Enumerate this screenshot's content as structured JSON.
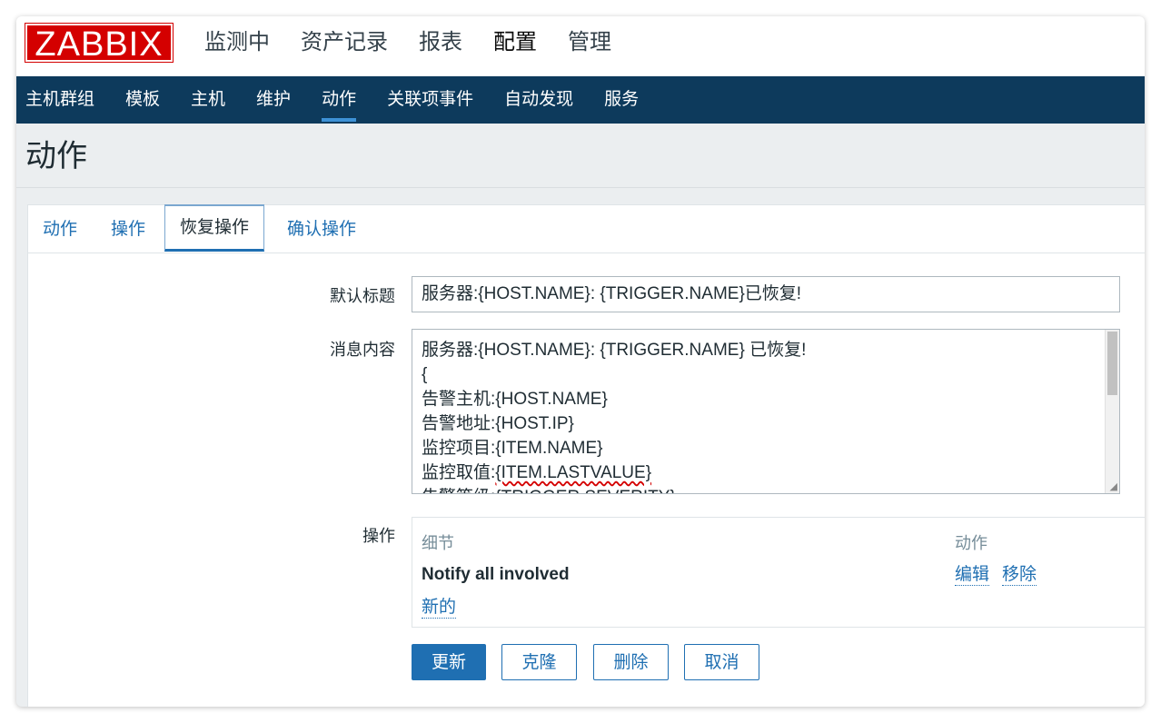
{
  "logo": "ZABBIX",
  "topmenu": [
    "监测中",
    "资产记录",
    "报表",
    "配置",
    "管理"
  ],
  "subnav": [
    "主机群组",
    "模板",
    "主机",
    "维护",
    "动作",
    "关联项事件",
    "自动发现",
    "服务"
  ],
  "page_title": "动作",
  "tabs": [
    "动作",
    "操作",
    "恢复操作",
    "确认操作"
  ],
  "form": {
    "default_subject_label": "默认标题",
    "default_subject_value": "服务器:{HOST.NAME}: {TRIGGER.NAME}已恢复!",
    "message_label": "消息内容",
    "message_lines": [
      "服务器:{HOST.NAME}: {TRIGGER.NAME} 已恢复!",
      "{",
      "告警主机:{HOST.NAME}",
      "告警地址:{HOST.IP}",
      "监控项目:{ITEM.NAME}",
      "监控取值:",
      "{ITEM.LASTVALUE}",
      "告警等级:{TRIGGER.SEVERITY}"
    ],
    "operations_label": "操作",
    "operations": {
      "col_details": "细节",
      "col_action": "动作",
      "row_details": "Notify all involved",
      "edit": "编辑",
      "remove": "移除",
      "new": "新的"
    }
  },
  "buttons": {
    "update": "更新",
    "clone": "克隆",
    "delete": "删除",
    "cancel": "取消"
  }
}
